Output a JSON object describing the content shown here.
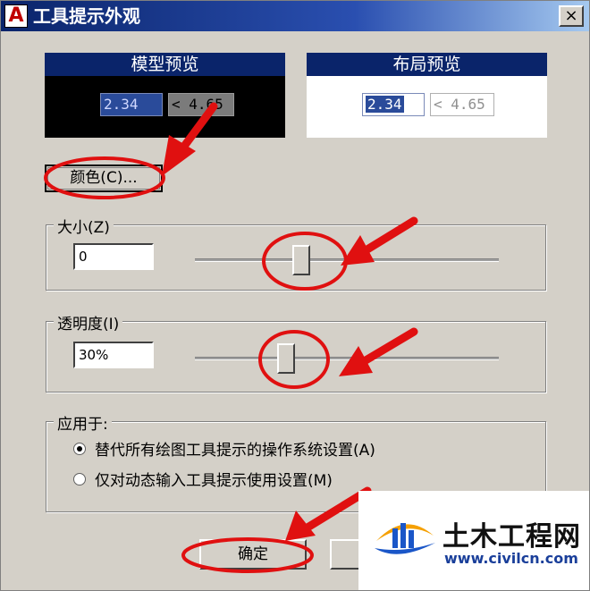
{
  "window": {
    "app_icon": "A",
    "title": "工具提示外观",
    "close_label": "×"
  },
  "preview": {
    "model_title": "模型预览",
    "layout_title": "布局预览",
    "value_a": "2.34",
    "value_b": "< 4.65"
  },
  "buttons": {
    "color_label": "颜色(C)...",
    "ok_label": "确定",
    "cancel_label": ""
  },
  "size_group": {
    "label": "大小(Z)",
    "value": "0",
    "slider_fraction": 0.35
  },
  "transparency_group": {
    "label": "透明度(I)",
    "value": "30%",
    "slider_fraction": 0.3
  },
  "apply_group": {
    "label": "应用于:",
    "options": [
      {
        "label": "替代所有绘图工具提示的操作系统设置(A)",
        "selected": true
      },
      {
        "label": "仅对动态输入工具提示使用设置(M)",
        "selected": false
      }
    ]
  },
  "annotations": {
    "color": "#e01010"
  },
  "watermark": {
    "name": "土木工程网",
    "url": "www.civilcn.com"
  }
}
